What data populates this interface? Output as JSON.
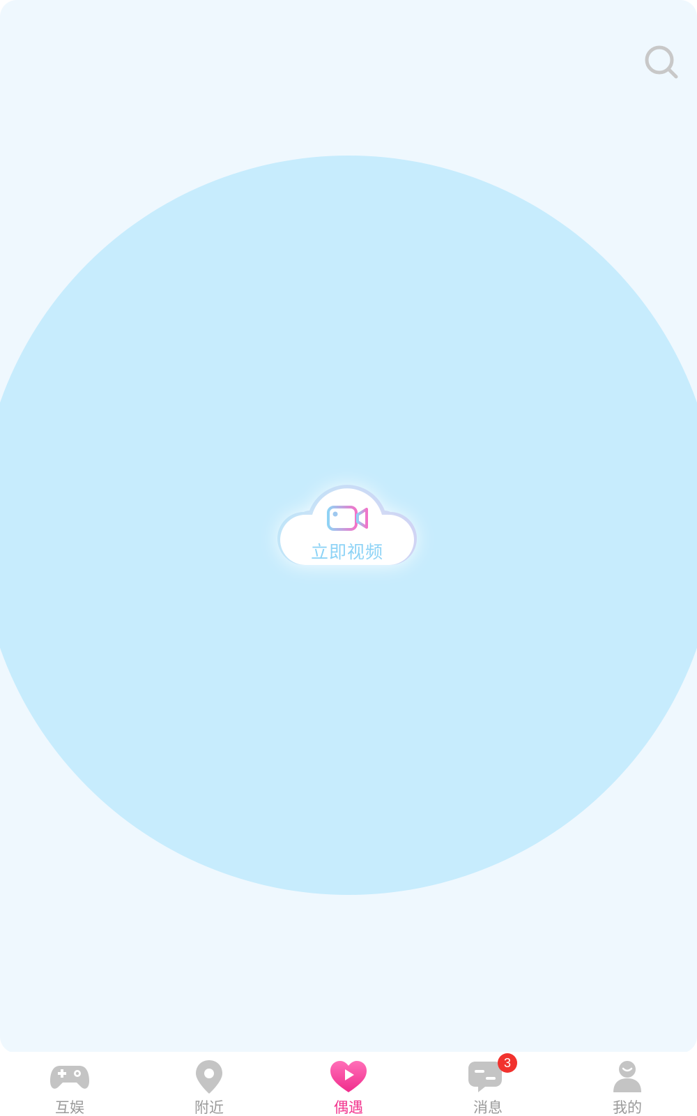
{
  "colors": {
    "page_background": "#eff8fe",
    "radar_circle": "#c7ecfd",
    "cloud_text": "#8dd3f6",
    "tab_inactive": "#9a9a9a",
    "tab_active": "#f2358e",
    "badge": "#f1322e"
  },
  "header": {
    "search_icon": "search-icon"
  },
  "main": {
    "cloud_button": {
      "label": "立即视频",
      "icon": "video-camera-icon"
    }
  },
  "tabbar": {
    "tabs": [
      {
        "label": "互娱",
        "icon": "gamepad-icon",
        "active": false
      },
      {
        "label": "附近",
        "icon": "location-pin-icon",
        "active": false
      },
      {
        "label": "偶遇",
        "icon": "heart-play-icon",
        "active": true
      },
      {
        "label": "消息",
        "icon": "chat-bubble-icon",
        "active": false,
        "badge": "3"
      },
      {
        "label": "我的",
        "icon": "user-icon",
        "active": false
      }
    ]
  }
}
